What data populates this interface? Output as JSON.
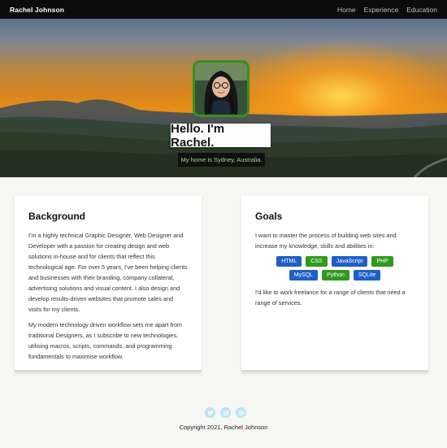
{
  "nav": {
    "brand": "Rachel Johnson",
    "links": [
      "Home",
      "Experience",
      "Education"
    ]
  },
  "hero": {
    "title": "Hello. I'm Rachel.",
    "subtitle": "My home is Sydney, Australia."
  },
  "background": {
    "heading": "Background",
    "paragraphs": [
      "I'm a highly technical Graphic Designer, Web Designer and Developer with a passion for creating design and web solutions in-house and for clients that reflect this technological age. For over 5 years, I've been helping clients and businesses with their branding, company collateral, advertising solutions and visual content. I also design and develop results-driven websites that promote sales and visits for my clients.",
      "My modern technology driven workflow sets me apart from traditional Designers, as I subscribe to new technologies, utilising macros, scripts, commands, and programming fundamentals to maximise workflow."
    ]
  },
  "goals": {
    "heading": "Goals",
    "intro": "I want to master the process of building web sites and increase my knowledge, skills and abilities in:",
    "skills": [
      {
        "label": "HTML",
        "color": "#1f5fc7"
      },
      {
        "label": "CSS",
        "color": "#2f9a1e"
      },
      {
        "label": "JavaScript",
        "color": "#1f5fc7"
      },
      {
        "label": "PHP",
        "color": "#2f9a1e"
      },
      {
        "label": "MySQL",
        "color": "#1f5fc7"
      },
      {
        "label": "Python",
        "color": "#2f9a1e"
      },
      {
        "label": "SQLite",
        "color": "#1f5fc7"
      }
    ],
    "outro": "I'd like to work freelance for a range of clients that need a range of services."
  },
  "footer": {
    "social_icons": [
      "twitter-icon",
      "instagram-icon",
      "email-icon"
    ],
    "copyright": "Copyright 2021, Rachel Johnson"
  }
}
